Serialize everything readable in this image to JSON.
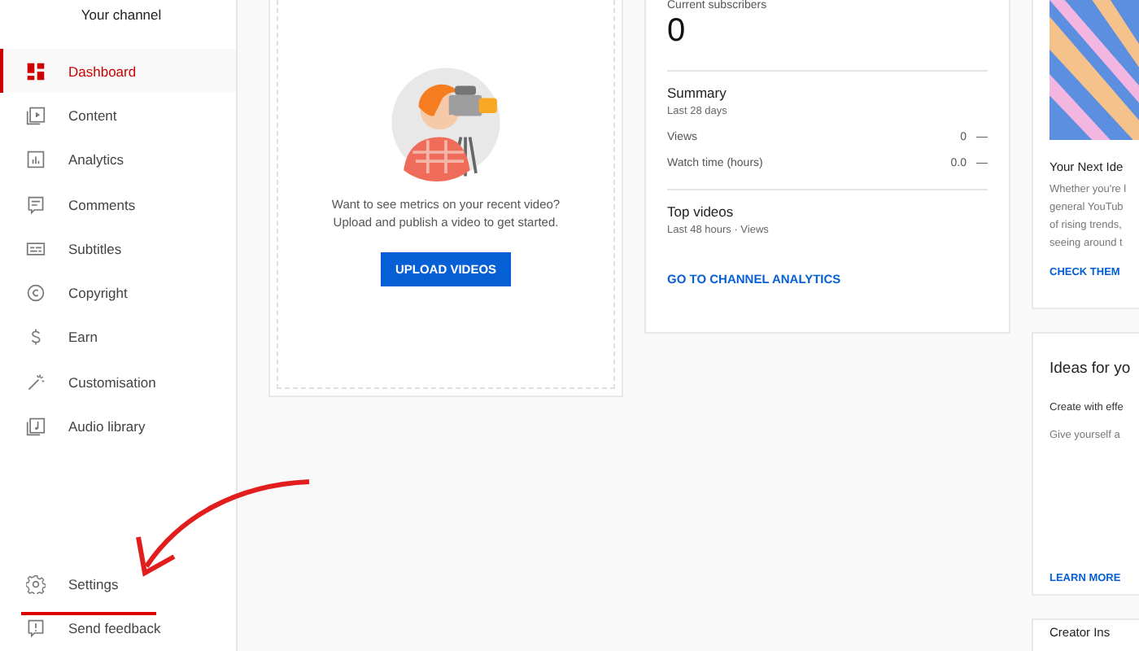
{
  "sidebar": {
    "channel_label": "Your channel",
    "items": [
      {
        "label": "Dashboard",
        "selected": true
      },
      {
        "label": "Content",
        "selected": false
      },
      {
        "label": "Analytics",
        "selected": false
      },
      {
        "label": "Comments",
        "selected": false
      },
      {
        "label": "Subtitles",
        "selected": false
      },
      {
        "label": "Copyright",
        "selected": false
      },
      {
        "label": "Earn",
        "selected": false
      },
      {
        "label": "Customisation",
        "selected": false
      },
      {
        "label": "Audio library",
        "selected": false
      }
    ],
    "bottom_items": [
      {
        "label": "Settings",
        "selected": false
      },
      {
        "label": "Send feedback",
        "selected": false
      }
    ]
  },
  "video_card": {
    "message": [
      "Want to see metrics on your recent video?",
      "Upload and publish a video to get started."
    ],
    "button": "UPLOAD VIDEOS"
  },
  "analytics_card": {
    "subscribers_label": "Current subscribers",
    "subscribers": "0",
    "summary": {
      "title": "Summary",
      "period": "Last 28 days",
      "rows": [
        {
          "label": "Views",
          "value": "0",
          "trend": "—"
        },
        {
          "label": "Watch time (hours)",
          "value": "0.0",
          "trend": "—"
        }
      ]
    },
    "top_videos": {
      "title": "Top videos",
      "period": "Last 48 hours · Views"
    },
    "link": "GO TO CHANNEL ANALYTICS"
  },
  "right_cards": [
    {
      "title": "Your Next Ide",
      "lines": [
        "Whether you're l",
        "general YouTub",
        "of rising trends,",
        "seeing around t"
      ],
      "link": "CHECK THEM"
    },
    {
      "title": "Ideas for yo",
      "subtitle": "Create with effe",
      "lines": [
        "Give yourself a"
      ],
      "link": "LEARN MORE"
    },
    {
      "title": "Creator Ins"
    }
  ]
}
